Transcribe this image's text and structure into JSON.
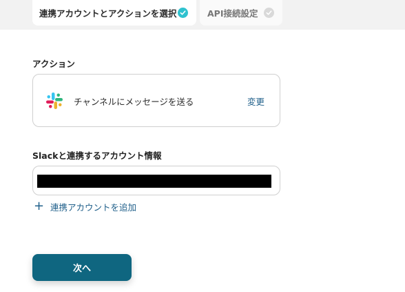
{
  "tabs": [
    {
      "label": "連携アカウントとアクションを選択",
      "completed": true
    },
    {
      "label": "API接続設定",
      "completed": false
    }
  ],
  "action_section": {
    "label": "アクション",
    "app_icon": "slack-icon",
    "action_name": "チャンネルにメッセージを送る",
    "change_label": "変更"
  },
  "account_section": {
    "label": "Slackと連携するアカウント情報",
    "value_redacted": true,
    "add_label": "連携アカウントを追加"
  },
  "next_button": {
    "label": "次へ"
  },
  "colors": {
    "accent": "#0f6680",
    "link": "#1f5f8a",
    "check_done": "#2fc2cf",
    "check_pending": "#d9d9d9"
  }
}
